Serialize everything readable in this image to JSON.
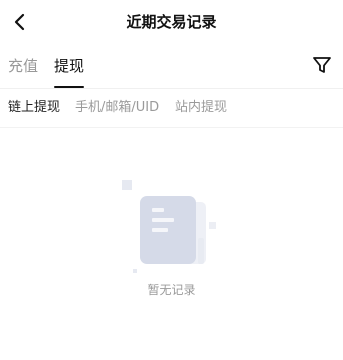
{
  "header": {
    "title": "近期交易记录",
    "back_icon": "chevron-left-icon"
  },
  "tabs": [
    {
      "label": "充值",
      "active": false
    },
    {
      "label": "提现",
      "active": true
    }
  ],
  "filter_icon": "filter-icon",
  "subtabs": [
    {
      "label": "链上提现",
      "active": true
    },
    {
      "label": "手机/邮箱/UID",
      "active": false
    },
    {
      "label": "站内提现",
      "active": false
    }
  ],
  "empty_state": {
    "icon": "document-empty-icon",
    "text": "暂无记录"
  },
  "colors": {
    "active_text": "#111111",
    "inactive_text": "#999999",
    "illustration": "#dfe3ee"
  }
}
